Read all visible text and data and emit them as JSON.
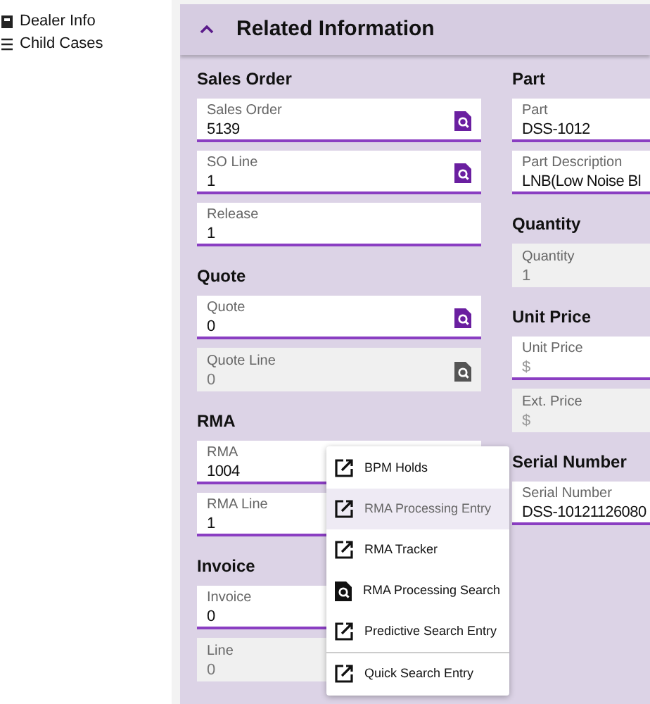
{
  "sidebar": {
    "items": [
      {
        "label": "Dealer Info",
        "kind": "card"
      },
      {
        "label": "Child Cases",
        "kind": "list"
      }
    ]
  },
  "panel": {
    "title": "Related Information",
    "expanded": true,
    "columns": [
      [
        {
          "heading": "Sales Order",
          "fields": [
            {
              "label": "Sales Order",
              "value": "5139",
              "kind": "editable",
              "search": true
            },
            {
              "label": "SO Line",
              "value": "1",
              "kind": "editable",
              "search": true
            },
            {
              "label": "Release",
              "value": "1",
              "kind": "editable",
              "search": false
            }
          ]
        },
        {
          "heading": "Quote",
          "fields": [
            {
              "label": "Quote",
              "value": "0",
              "kind": "editable",
              "search": true
            },
            {
              "label": "Quote Line",
              "value": "0",
              "kind": "readonly",
              "search": true
            }
          ]
        },
        {
          "heading": "RMA",
          "fields": [
            {
              "label": "RMA",
              "value": "1004",
              "kind": "editable",
              "search": false
            },
            {
              "label": "RMA Line",
              "value": "1",
              "kind": "editable",
              "search": false
            }
          ]
        },
        {
          "heading": "Invoice",
          "fields": [
            {
              "label": "Invoice",
              "value": "0",
              "kind": "editable",
              "search": false
            },
            {
              "label": "Line",
              "value": "0",
              "kind": "readonly",
              "search": false
            }
          ]
        }
      ],
      [
        {
          "heading": "Part",
          "fields": [
            {
              "label": "Part",
              "value": "DSS-1012",
              "kind": "editable",
              "search": false
            },
            {
              "label": "Part Description",
              "value": "LNB(Low Noise Bl",
              "kind": "editable",
              "search": false
            }
          ]
        },
        {
          "heading": "Quantity",
          "fields": [
            {
              "label": "Quantity",
              "value": "1",
              "kind": "readonly",
              "search": false
            }
          ]
        },
        {
          "heading": "Unit Price",
          "fields": [
            {
              "label": "Unit Price",
              "placeholder": "$",
              "kind": "editable",
              "search": false
            },
            {
              "label": "Ext. Price",
              "placeholder": "$",
              "kind": "readonly",
              "search": false
            }
          ]
        },
        {
          "heading": "Serial Number",
          "fields": [
            {
              "label": "Serial Number",
              "value": "DSS-10121126080",
              "kind": "editable",
              "search": false
            }
          ]
        }
      ]
    ]
  },
  "menu": {
    "items": [
      {
        "label": "BPM Holds",
        "kind": "link",
        "selected": false,
        "divider_before": false
      },
      {
        "label": "RMA Processing Entry",
        "kind": "link",
        "selected": true,
        "divider_before": false
      },
      {
        "label": "RMA Tracker",
        "kind": "link",
        "selected": false,
        "divider_before": false
      },
      {
        "label": "RMA Processing Search",
        "kind": "search",
        "selected": false,
        "divider_before": false
      },
      {
        "label": "Predictive Search Entry",
        "kind": "link",
        "selected": false,
        "divider_before": false
      },
      {
        "label": "Quick Search Entry",
        "kind": "link",
        "selected": false,
        "divider_before": true
      }
    ]
  }
}
